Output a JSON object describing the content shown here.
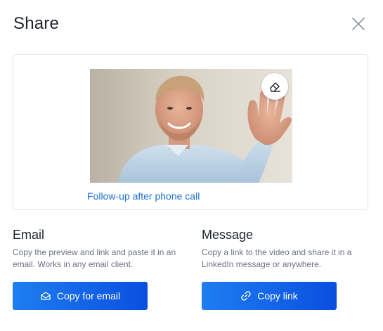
{
  "dialog": {
    "title": "Share"
  },
  "preview": {
    "video_title": "Follow-up after phone call"
  },
  "email": {
    "heading": "Email",
    "description": "Copy the preview and link and paste it in an email. Works in any email client.",
    "button_label": "Copy for email"
  },
  "message": {
    "heading": "Message",
    "description": "Copy a link to the video and share it in a LinkedIn message or anywhere.",
    "button_label": "Copy link"
  },
  "icons": {
    "close": "close-icon",
    "edit_thumbnail": "eraser-icon",
    "email": "envelope-open-icon",
    "link": "link-icon"
  },
  "colors": {
    "accent": "#1c6fcf",
    "button_gradient_start": "#1e7ef0",
    "button_gradient_end": "#0a4fe0",
    "border": "#e3e6ea"
  }
}
